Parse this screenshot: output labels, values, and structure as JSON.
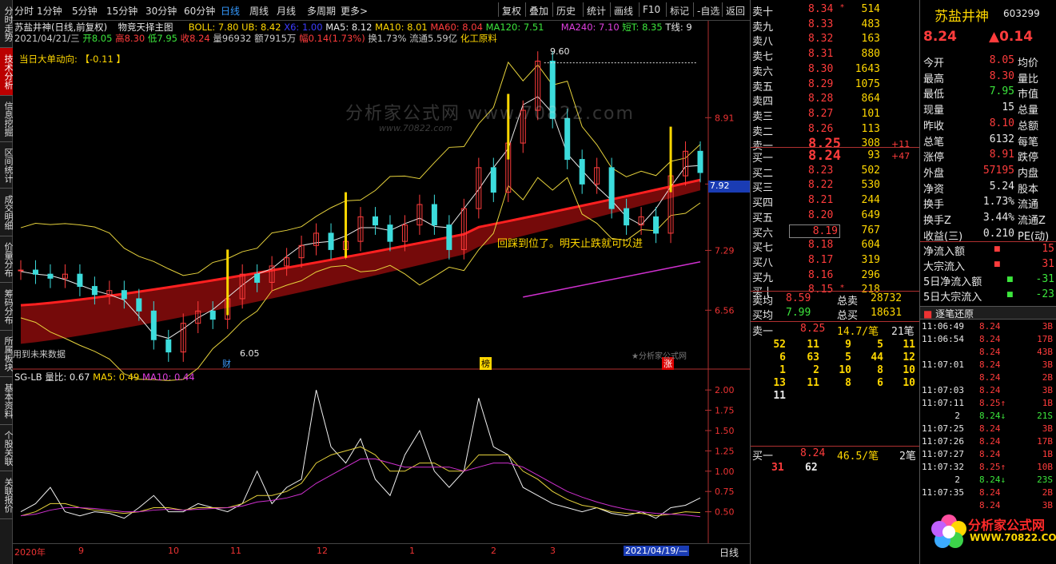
{
  "vtabs": [
    "分时走势",
    "技术分析",
    "信息挖掘",
    "区间统计",
    "成交明细",
    "价量分布",
    "筹码分布",
    "所属板块",
    "基本资料",
    "个股关联",
    "关联报价"
  ],
  "toolbar": {
    "left": [
      "分时",
      "1分钟",
      "5分钟",
      "15分钟",
      "30分钟",
      "60分钟",
      "日线",
      "周线",
      "月线",
      "多周期",
      "更多>"
    ],
    "right": [
      "复权",
      "叠加",
      "历史",
      "统计",
      "画线",
      "F10",
      "标记",
      "-自选",
      "返回"
    ]
  },
  "header": {
    "stock_title": "苏盐井神(日线,前复权)",
    "indicator_name": "物竞天择主图",
    "boll": "BOLL: 7.80",
    "ub": "UB: 8.42",
    "x6": "X6: 1.00",
    "ma5": "MA5: 8.12",
    "ma10": "MA10: 8.01",
    "ma60": "MA60: 8.04",
    "ma120": "MA120: 7.51",
    "ma240": "MA240: 7.10",
    "short": "短T: 8.35",
    "t": "T线: 9",
    "line2": {
      "date": "2021/04/21/三",
      "open": "开8.05",
      "high": "高8.30",
      "low": "低7.95",
      "close": "收8.24",
      "vol": "量96932",
      "amt": "额7915万",
      "amp": "幅0.14(1.73%)",
      "turn": "换1.73%",
      "float": "流通5.59亿",
      "sector": "化工原料"
    },
    "big_order": "当日大单动向: 【-0.11 】"
  },
  "watermark": {
    "brand": "分析家公式网",
    "url1": "www.70822.com",
    "url2": "www.70822.com"
  },
  "annotations": {
    "high_price": "9.60",
    "low_price": "6.05",
    "note": "回踩到位了。明天止跌就可以进",
    "future_data": "用到未来数据",
    "tag_cai": "财",
    "tag_bang": "榜",
    "tag_zhang": "涨",
    "source": "★分析家公式网",
    "current_price_tag": "7.92"
  },
  "chart_data": [
    {
      "type": "line",
      "title": "",
      "y_ticks": [
        "8.91",
        "8.10",
        "7.29",
        "6.56"
      ],
      "x_ticks": [
        "2020年",
        "9",
        "10",
        "11",
        "12",
        "1",
        "2",
        "3",
        "2021/04/19/—"
      ],
      "series": [
        {
          "name": "close",
          "values": [
            7.05,
            7.0,
            6.95,
            7.0,
            6.85,
            6.75,
            6.8,
            6.7,
            6.55,
            6.2,
            6.05,
            6.4,
            6.55,
            6.45,
            6.7,
            7.0,
            6.9,
            7.1,
            7.2,
            7.35,
            7.5,
            7.3,
            7.4,
            7.7,
            7.6,
            7.4,
            7.6,
            7.85,
            7.6,
            7.3,
            7.8,
            8.3,
            8.0,
            8.6,
            9.0,
            9.6,
            8.9,
            8.4,
            8.1,
            8.3,
            7.8,
            7.6,
            7.7,
            7.5,
            8.2,
            8.5,
            8.24
          ]
        }
      ]
    },
    {
      "type": "line",
      "title": "SG-LB",
      "labels": {
        "ratio": "量比: 0.67",
        "ma5": "MA5: 0.49",
        "ma10": "MA10: 0.44"
      },
      "y_ticks": [
        "2.00",
        "1.75",
        "1.50",
        "1.25",
        "1.00",
        "0.75",
        "0.50"
      ],
      "series": [
        {
          "name": "量比",
          "values": [
            0.5,
            0.6,
            0.8,
            0.5,
            0.45,
            0.5,
            0.48,
            0.42,
            0.55,
            0.7,
            0.5,
            0.5,
            0.6,
            0.55,
            0.5,
            0.6,
            1.0,
            0.6,
            0.8,
            0.9,
            2.0,
            1.3,
            1.1,
            1.4,
            0.9,
            0.7,
            1.2,
            1.5,
            1.0,
            0.8,
            1.0,
            1.9,
            1.3,
            1.2,
            0.8,
            0.7,
            0.6,
            0.55,
            0.5,
            0.55,
            0.48,
            0.45,
            0.5,
            0.42,
            0.55,
            0.58,
            0.67
          ]
        },
        {
          "name": "MA5",
          "values": [
            0.45,
            0.5,
            0.6,
            0.6,
            0.55,
            0.52,
            0.5,
            0.48,
            0.5,
            0.55,
            0.55,
            0.52,
            0.55,
            0.55,
            0.55,
            0.6,
            0.7,
            0.7,
            0.75,
            0.85,
            1.1,
            1.2,
            1.25,
            1.3,
            1.2,
            1.0,
            1.0,
            1.1,
            1.1,
            1.0,
            1.0,
            1.2,
            1.2,
            1.2,
            1.0,
            0.9,
            0.75,
            0.65,
            0.58,
            0.55,
            0.5,
            0.48,
            0.48,
            0.45,
            0.47,
            0.5,
            0.49
          ]
        },
        {
          "name": "MA10",
          "values": [
            0.45,
            0.47,
            0.52,
            0.55,
            0.55,
            0.54,
            0.52,
            0.5,
            0.5,
            0.52,
            0.53,
            0.52,
            0.53,
            0.54,
            0.55,
            0.57,
            0.62,
            0.64,
            0.67,
            0.72,
            0.85,
            0.95,
            1.05,
            1.15,
            1.15,
            1.1,
            1.05,
            1.05,
            1.05,
            1.05,
            1.0,
            1.05,
            1.1,
            1.1,
            1.05,
            0.95,
            0.85,
            0.75,
            0.68,
            0.62,
            0.57,
            0.53,
            0.5,
            0.48,
            0.47,
            0.46,
            0.44
          ]
        }
      ]
    }
  ],
  "orderbook": {
    "asks": [
      {
        "label": "卖十",
        "price": "8.34",
        "mark": "*",
        "vol": "514"
      },
      {
        "label": "卖九",
        "price": "8.33",
        "mark": "",
        "vol": "483"
      },
      {
        "label": "卖八",
        "price": "8.32",
        "mark": "",
        "vol": "163"
      },
      {
        "label": "卖七",
        "price": "8.31",
        "mark": "",
        "vol": "880"
      },
      {
        "label": "卖六",
        "price": "8.30",
        "mark": "",
        "vol": "1643"
      },
      {
        "label": "卖五",
        "price": "8.29",
        "mark": "",
        "vol": "1075"
      },
      {
        "label": "卖四",
        "price": "8.28",
        "mark": "",
        "vol": "864"
      },
      {
        "label": "卖三",
        "price": "8.27",
        "mark": "",
        "vol": "101"
      },
      {
        "label": "卖二",
        "price": "8.26",
        "mark": "",
        "vol": "113"
      },
      {
        "label": "卖一",
        "price": "8.25",
        "mark": "",
        "vol": "308",
        "chg": "+11"
      }
    ],
    "bids": [
      {
        "label": "买一",
        "price": "8.24",
        "vol": "93",
        "chg": "+47"
      },
      {
        "label": "买二",
        "price": "8.23",
        "vol": "502"
      },
      {
        "label": "买三",
        "price": "8.22",
        "vol": "530"
      },
      {
        "label": "买四",
        "price": "8.21",
        "vol": "244"
      },
      {
        "label": "买五",
        "price": "8.20",
        "vol": "649"
      },
      {
        "label": "买六",
        "price": "8.19",
        "vol": "767"
      },
      {
        "label": "买七",
        "price": "8.18",
        "vol": "604"
      },
      {
        "label": "买八",
        "price": "8.17",
        "vol": "319"
      },
      {
        "label": "买九",
        "price": "8.16",
        "vol": "296"
      },
      {
        "label": "买十",
        "price": "8.15",
        "mark": "*",
        "vol": "218"
      }
    ],
    "sell_avg_label": "卖均",
    "sell_avg": "8.59",
    "sell_total_label": "总卖",
    "sell_total": "28732",
    "buy_avg_label": "买均",
    "buy_avg": "7.99",
    "buy_total_label": "总买",
    "buy_total": "18631",
    "queue_sell": {
      "label": "卖一",
      "price": "8.25",
      "avg": "14.7/笔",
      "count": "21笔"
    },
    "queue_sell_rows": [
      [
        "52",
        "11",
        "9",
        "5",
        "11"
      ],
      [
        "6",
        "63",
        "5",
        "44",
        "12"
      ],
      [
        "1",
        "2",
        "10",
        "8",
        "10"
      ],
      [
        "13",
        "11",
        "8",
        "6",
        "10"
      ],
      [
        "11"
      ]
    ],
    "queue_buy": {
      "label": "买一",
      "price": "8.24",
      "avg": "46.5/笔",
      "count": "2笔"
    },
    "queue_buy_rows": [
      [
        "31",
        "62"
      ]
    ]
  },
  "stock": {
    "name": "苏盐井神",
    "code": "603299",
    "price": "8.24",
    "change": "▲0.14",
    "rows": [
      {
        "l": "今开",
        "v": "8.05",
        "r": "均价"
      },
      {
        "l": "最高",
        "v": "8.30",
        "r": "量比"
      },
      {
        "l": "最低",
        "v": "7.95",
        "r": "市值"
      },
      {
        "l": "现量",
        "v": "15",
        "r": "总量"
      },
      {
        "l": "昨收",
        "v": "8.10",
        "r": "总额"
      },
      {
        "l": "总笔",
        "v": "6132",
        "r": "每笔"
      },
      {
        "l": "涨停",
        "v": "8.91",
        "r": "跌停"
      },
      {
        "l": "外盘",
        "v": "57195",
        "r": "内盘"
      },
      {
        "l": "净资",
        "v": "5.24",
        "r": "股本"
      },
      {
        "l": "换手",
        "v": "1.73%",
        "r": "流通"
      },
      {
        "l": "换手Z",
        "v": "3.44%",
        "r": "流通Z"
      },
      {
        "l": "收益(三)",
        "v": "0.210",
        "r": "PE(动)"
      }
    ],
    "flows": [
      {
        "l": "净流入额",
        "v": "15"
      },
      {
        "l": "大宗流入",
        "v": "31"
      },
      {
        "l": "5日净流入额",
        "v": "-31"
      },
      {
        "l": "5日大宗流入",
        "v": "-23"
      }
    ],
    "ticks_title": "逐笔还原",
    "ticks": [
      {
        "t": "11:06:49",
        "p": "8.24",
        "v": "3B"
      },
      {
        "t": "11:06:54",
        "p": "8.24",
        "v": "17B"
      },
      {
        "t": "",
        "p": "8.24",
        "v": "43B"
      },
      {
        "t": "11:07:01",
        "p": "8.24",
        "v": "3B"
      },
      {
        "t": "",
        "p": "8.24",
        "v": "2B"
      },
      {
        "t": "11:07:03",
        "p": "8.24",
        "v": "3B"
      },
      {
        "t": "11:07:11",
        "p": "8.25↑",
        "v": "1B"
      },
      {
        "t": "2",
        "p": "8.24↓",
        "v": "21S"
      },
      {
        "t": "11:07:25",
        "p": "8.24",
        "v": "3B"
      },
      {
        "t": "11:07:26",
        "p": "8.24",
        "v": "17B"
      },
      {
        "t": "11:07:27",
        "p": "8.24",
        "v": "1B"
      },
      {
        "t": "11:07:32",
        "p": "8.25↑",
        "v": "10B"
      },
      {
        "t": "2",
        "p": "8.24↓",
        "v": "23S"
      },
      {
        "t": "11:07:35",
        "p": "8.24",
        "v": "2B"
      },
      {
        "t": "",
        "p": "8.24",
        "v": "3B"
      }
    ]
  },
  "bottom": {
    "period": "日线"
  },
  "logo": {
    "brand": "分析家公式网",
    "url": "WWW.70822.COM"
  },
  "colors": {
    "up": "#ff3c3c",
    "down": "#3ce63c",
    "accent": "#3399ff"
  }
}
